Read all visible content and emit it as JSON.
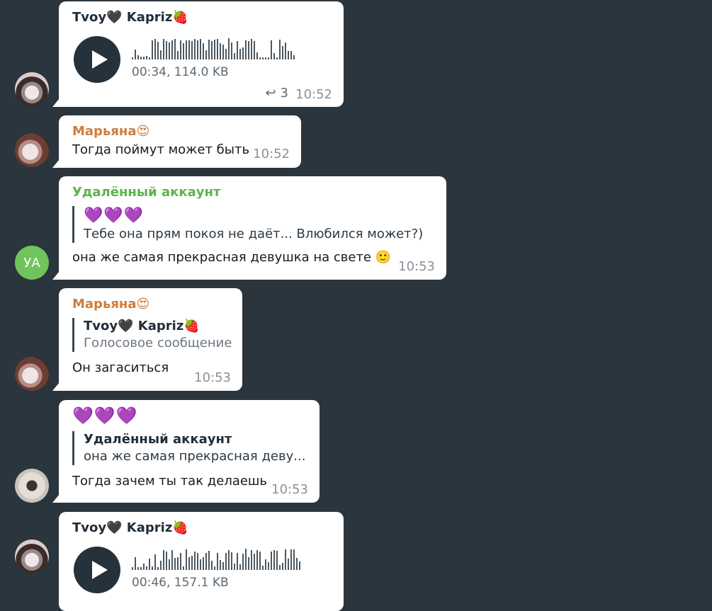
{
  "messages": [
    {
      "sender": "Tvoy🖤 Kapriz🍓",
      "type": "voice",
      "meta": "00:34, 114.0 KB",
      "replies": "3",
      "time": "10:52",
      "wave": [
        3,
        14,
        6,
        4,
        4,
        5,
        3,
        27,
        29,
        25,
        13,
        29,
        26,
        24,
        27,
        29,
        12,
        27,
        23,
        27,
        27,
        26,
        29,
        27,
        29,
        23,
        13,
        28,
        26,
        28,
        29,
        23,
        21,
        15,
        30,
        24,
        9,
        26,
        15,
        17,
        27,
        26,
        29,
        26,
        10,
        3,
        3,
        3,
        3,
        27,
        9,
        3,
        28,
        19,
        24,
        12,
        12,
        6
      ]
    },
    {
      "sender": "Марьяна😍",
      "text": "Тогда поймут может быть",
      "time": "10:52"
    },
    {
      "sender": "Удалённый аккаунт",
      "avatar_initials": "УА",
      "quote_hearts": "💜💜💜",
      "quote_text": "Тебе она прям покоя не даёт... Влюбился может?)",
      "text": "она же самая прекрасная девушка на свете 🙂",
      "time": "10:53"
    },
    {
      "sender": "Марьяна😍",
      "quote_name": "Tvoy🖤 Kapriz🍓",
      "quote_text": "Голосовое сообщение",
      "text": "Он загаситься",
      "time": "10:53"
    },
    {
      "hearts": "💜💜💜",
      "quote_name": "Удалённый аккаунт",
      "quote_text": "она же самая прекрасная деву...",
      "text": "Тогда зачем ты так делаешь",
      "time": "10:53"
    },
    {
      "sender": "Tvoy🖤 Kapriz🍓",
      "type": "voice",
      "meta": "00:46, 157.1 KB",
      "wave": [
        4,
        18,
        4,
        4,
        9,
        5,
        16,
        5,
        22,
        4,
        13,
        28,
        26,
        15,
        28,
        17,
        18,
        24,
        5,
        29,
        18,
        20,
        26,
        24,
        15,
        18,
        24,
        27,
        13,
        5,
        24,
        14,
        11,
        24,
        28,
        25,
        9,
        24,
        8,
        23,
        30,
        18,
        28,
        23,
        28,
        26,
        6,
        15,
        11,
        26,
        28,
        27,
        7,
        10,
        29,
        16,
        29,
        29,
        17,
        12
      ]
    }
  ],
  "colors": {
    "background": "#2b353d",
    "bubble": "#ffffff",
    "avatar_green": "#6fc45b",
    "name_orange": "#d07d3a",
    "name_green": "#5ab44a"
  }
}
